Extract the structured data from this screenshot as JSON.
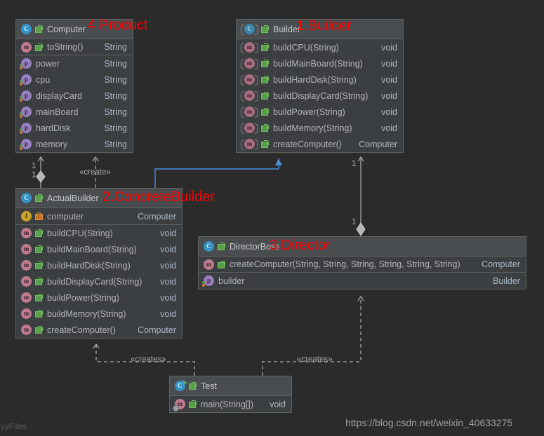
{
  "diagram": {
    "kind": "uml-class-diagram",
    "background": "#2b2b2b",
    "annotation_color": "#fe0000"
  },
  "classes": {
    "computer": {
      "name": "Computer",
      "annotation": "4.Product",
      "icon": "class-icon",
      "members": [
        {
          "name": "toString()",
          "type": "String",
          "icon": "method-icon",
          "visibility": "public"
        },
        {
          "name": "power",
          "type": "String",
          "icon": "property-icon",
          "visibility": "public"
        },
        {
          "name": "cpu",
          "type": "String",
          "icon": "property-icon",
          "visibility": "public"
        },
        {
          "name": "displayCard",
          "type": "String",
          "icon": "property-icon",
          "visibility": "public"
        },
        {
          "name": "mainBoard",
          "type": "String",
          "icon": "property-icon",
          "visibility": "public"
        },
        {
          "name": "hardDisk",
          "type": "String",
          "icon": "property-icon",
          "visibility": "public"
        },
        {
          "name": "memory",
          "type": "String",
          "icon": "property-icon",
          "visibility": "public"
        }
      ]
    },
    "builder": {
      "name": "Builder",
      "annotation": "1.Builder",
      "icon": "abstract-class-icon",
      "members": [
        {
          "name": "buildCPU(String)",
          "type": "void",
          "icon": "abstract-method-icon",
          "visibility": "public"
        },
        {
          "name": "buildMainBoard(String)",
          "type": "void",
          "icon": "abstract-method-icon",
          "visibility": "public"
        },
        {
          "name": "buildHardDisk(String)",
          "type": "void",
          "icon": "abstract-method-icon",
          "visibility": "public"
        },
        {
          "name": "buildDisplayCard(String)",
          "type": "void",
          "icon": "abstract-method-icon",
          "visibility": "public"
        },
        {
          "name": "buildPower(String)",
          "type": "void",
          "icon": "abstract-method-icon",
          "visibility": "public"
        },
        {
          "name": "buildMemory(String)",
          "type": "void",
          "icon": "abstract-method-icon",
          "visibility": "public"
        },
        {
          "name": "createComputer()",
          "type": "Computer",
          "icon": "abstract-method-icon",
          "visibility": "public"
        }
      ]
    },
    "actual_builder": {
      "name": "ActualBuilder",
      "annotation": "2.ConcreteBuilder",
      "icon": "class-icon",
      "fields": [
        {
          "name": "computer",
          "type": "Computer",
          "icon": "field-icon",
          "visibility": "private"
        }
      ],
      "members": [
        {
          "name": "buildCPU(String)",
          "type": "void",
          "icon": "method-icon",
          "visibility": "public"
        },
        {
          "name": "buildMainBoard(String)",
          "type": "void",
          "icon": "method-icon",
          "visibility": "public"
        },
        {
          "name": "buildHardDisk(String)",
          "type": "void",
          "icon": "method-icon",
          "visibility": "public"
        },
        {
          "name": "buildDisplayCard(String)",
          "type": "void",
          "icon": "method-icon",
          "visibility": "public"
        },
        {
          "name": "buildPower(String)",
          "type": "void",
          "icon": "method-icon",
          "visibility": "public"
        },
        {
          "name": "buildMemory(String)",
          "type": "void",
          "icon": "method-icon",
          "visibility": "public"
        },
        {
          "name": "createComputer()",
          "type": "Computer",
          "icon": "method-icon",
          "visibility": "public"
        }
      ]
    },
    "director_boss": {
      "name": "DirectorBoss",
      "annotation": "3.Director",
      "icon": "class-icon",
      "members": [
        {
          "name": "createComputer(String, String, String, String, String, String)",
          "type": "Computer",
          "icon": "method-icon",
          "visibility": "public"
        },
        {
          "name": "builder",
          "type": "Builder",
          "icon": "property-icon",
          "visibility": "public"
        }
      ]
    },
    "test": {
      "name": "Test",
      "annotation": "",
      "icon": "runnable-class-icon",
      "members": [
        {
          "name": "main(String[])",
          "type": "void",
          "icon": "runnable-method-icon",
          "visibility": "public"
        }
      ]
    }
  },
  "relationships": {
    "aggregation_computer_actualbuilder": {
      "from": "ActualBuilder",
      "to": "Computer",
      "type": "aggregation",
      "source_multiplicity": "1",
      "target_multiplicity": "1",
      "label": ""
    },
    "create_actualbuilder_computer": {
      "from": "ActualBuilder",
      "to": "Computer",
      "type": "dependency",
      "label": "«create»"
    },
    "generalization_actualbuilder_builder": {
      "from": "ActualBuilder",
      "to": "Builder",
      "type": "generalization",
      "label": "",
      "color": "#4a90d9"
    },
    "aggregation_director_builder": {
      "from": "DirectorBoss",
      "to": "Builder",
      "type": "aggregation",
      "source_multiplicity": "1",
      "target_multiplicity": "1",
      "label": ""
    },
    "create_test_actualbuilder": {
      "from": "Test",
      "to": "ActualBuilder",
      "type": "dependency",
      "label": "«creates»"
    },
    "create_test_directorboss": {
      "from": "Test",
      "to": "DirectorBoss",
      "type": "dependency",
      "label": "«creates»"
    }
  },
  "overlays": {
    "watermark": "https://blog.csdn.net/weixin_40633275",
    "corner_text": "byyFiles"
  }
}
